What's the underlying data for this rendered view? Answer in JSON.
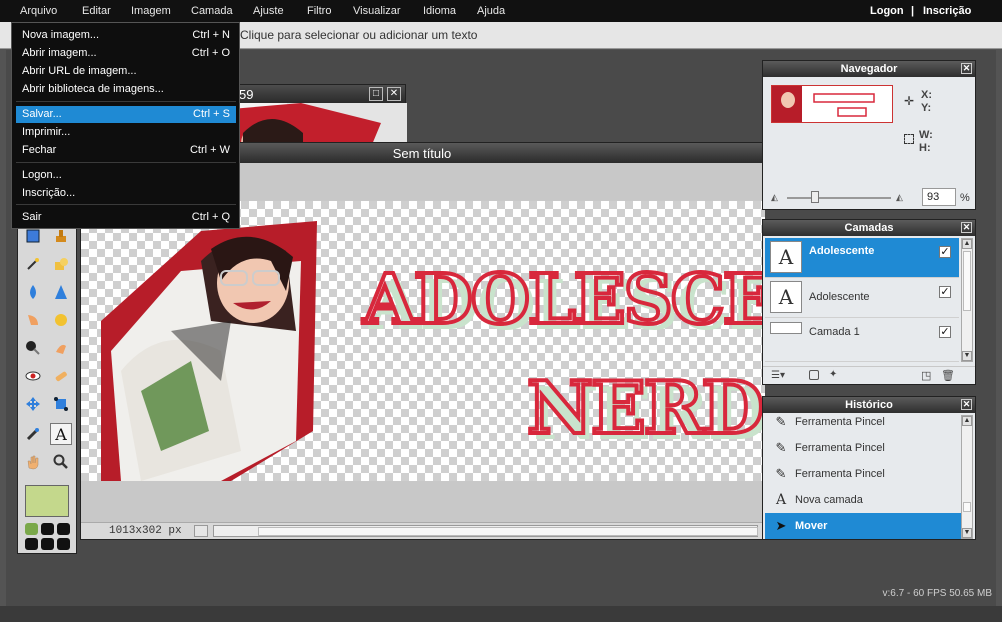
{
  "menubar": {
    "items": [
      "Arquivo",
      "Editar",
      "Imagem",
      "Camada",
      "Ajuste",
      "Filtro",
      "Visualizar",
      "Idioma",
      "Ajuda"
    ],
    "logon": "Logon",
    "separator": "|",
    "signup": "Inscrição"
  },
  "options_bar": {
    "hint": "Clique para selecionar ou adicionar um texto"
  },
  "file_menu": {
    "items": [
      {
        "label": "Nova imagem...",
        "shortcut": "Ctrl + N"
      },
      {
        "label": "Abrir imagem...",
        "shortcut": "Ctrl + O"
      },
      {
        "label": "Abrir URL de imagem...",
        "shortcut": ""
      },
      {
        "label": "Abrir biblioteca de imagens...",
        "shortcut": ""
      },
      {
        "label": "Salvar...",
        "shortcut": "Ctrl + S"
      },
      {
        "label": "Imprimir...",
        "shortcut": ""
      },
      {
        "label": "Fechar",
        "shortcut": "Ctrl + W"
      },
      {
        "label": "Logon...",
        "shortcut": ""
      },
      {
        "label": "Inscrição...",
        "shortcut": ""
      },
      {
        "label": "Sair",
        "shortcut": "Ctrl + Q"
      }
    ],
    "selected": "Salvar..."
  },
  "background_document": {
    "title_fragment": "59"
  },
  "main_document": {
    "title": "Sem título",
    "dimensions": "1013x302 px",
    "canvas_text_line1": "ADOLESCENTE",
    "canvas_text_line2": "NERD"
  },
  "navigator": {
    "title": "Navegador",
    "x_label": "X:",
    "y_label": "Y:",
    "w_label": "W:",
    "h_label": "H:",
    "zoom": "93",
    "zoom_unit": "%"
  },
  "layers": {
    "title": "Camadas",
    "items": [
      {
        "name": "Adolescente",
        "visible": "✓"
      },
      {
        "name": "Adolescente",
        "visible": "✓"
      },
      {
        "name": "Camada 1",
        "visible": "✓"
      }
    ]
  },
  "history": {
    "title": "Histórico",
    "items": [
      {
        "label": "Ferramenta Pincel",
        "icon": "brush-icon"
      },
      {
        "label": "Ferramenta Pincel",
        "icon": "brush-icon"
      },
      {
        "label": "Ferramenta Pincel",
        "icon": "brush-icon"
      },
      {
        "label": "Nova camada",
        "icon": "text-layer-icon"
      },
      {
        "label": "Mover",
        "icon": "move-icon"
      }
    ]
  },
  "colors": {
    "primary_color": "#c4d88c",
    "accent": "#1f8ad4",
    "text_red": "#d8283c",
    "text_mint": "#c9e3cc"
  },
  "status": {
    "version": "v:6.7 - 60 FPS 50.65 MB"
  }
}
